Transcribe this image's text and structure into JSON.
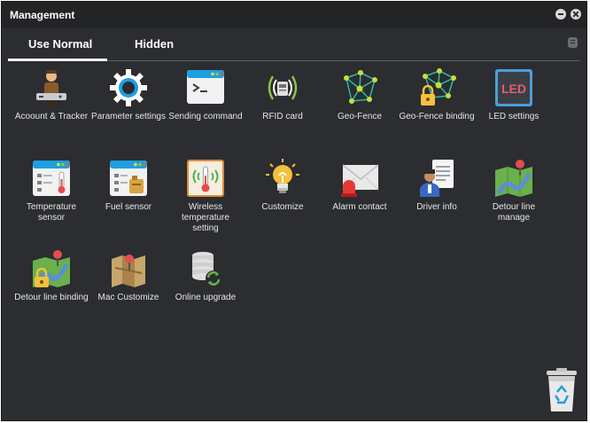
{
  "window": {
    "title": "Management"
  },
  "tabs": [
    {
      "label": "Use Normal"
    },
    {
      "label": "Hidden"
    }
  ],
  "items": [
    {
      "label": "Acoount & Tracker",
      "icon": "account-tracker-icon"
    },
    {
      "label": "Parameter settings",
      "icon": "gear-icon"
    },
    {
      "label": "Sending command",
      "icon": "terminal-icon"
    },
    {
      "label": "RFID card",
      "icon": "rfid-icon"
    },
    {
      "label": "Geo-Fence",
      "icon": "geo-fence-icon"
    },
    {
      "label": "Geo-Fence binding",
      "icon": "geo-fence-lock-icon"
    },
    {
      "label": "LED settings",
      "icon": "led-icon"
    },
    {
      "label": "Temperature sensor",
      "icon": "thermometer-window-icon"
    },
    {
      "label": "Fuel sensor",
      "icon": "fuel-window-icon"
    },
    {
      "label": "Wireless temperature setting",
      "icon": "wireless-thermometer-icon"
    },
    {
      "label": "Customize",
      "icon": "lightbulb-icon"
    },
    {
      "label": "Alarm contact",
      "icon": "alarm-envelope-icon"
    },
    {
      "label": "Driver info",
      "icon": "driver-document-icon"
    },
    {
      "label": "Detour line manage",
      "icon": "map-pin-icon"
    },
    {
      "label": "Detour line binding",
      "icon": "map-lock-icon"
    },
    {
      "label": "Mac Customize",
      "icon": "map-fold-icon"
    },
    {
      "label": "Online upgrade",
      "icon": "database-refresh-icon"
    }
  ]
}
